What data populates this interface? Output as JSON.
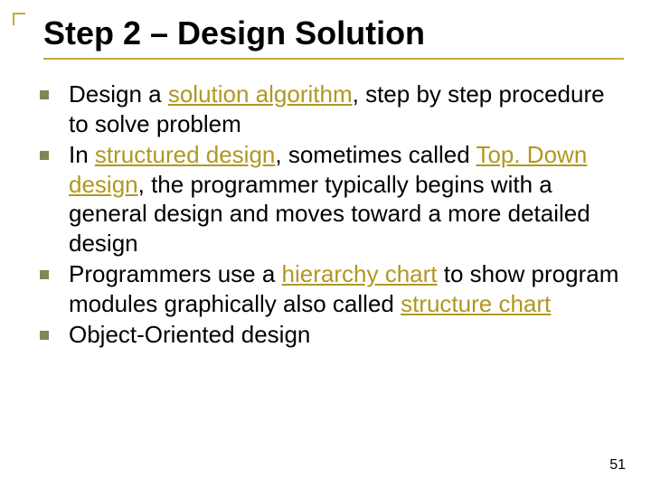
{
  "title": "Step 2 – Design Solution",
  "bullets": [
    {
      "segments": [
        {
          "text": "Design a ",
          "hl": false
        },
        {
          "text": "solution algorithm",
          "hl": true
        },
        {
          "text": ", step by step procedure to solve problem",
          "hl": false
        }
      ]
    },
    {
      "segments": [
        {
          "text": "In ",
          "hl": false
        },
        {
          "text": "structured design",
          "hl": true
        },
        {
          "text": ", sometimes called ",
          "hl": false
        },
        {
          "text": "Top. Down design",
          "hl": true
        },
        {
          "text": ", the programmer typically begins with a general design and moves toward a more detailed design",
          "hl": false
        }
      ]
    },
    {
      "segments": [
        {
          "text": "Programmers use a ",
          "hl": false
        },
        {
          "text": "hierarchy chart",
          "hl": true
        },
        {
          "text": " to show program modules graphically also called ",
          "hl": false
        },
        {
          "text": "structure chart",
          "hl": true
        }
      ]
    },
    {
      "segments": [
        {
          "text": "Object-Oriented design",
          "hl": false
        }
      ]
    }
  ],
  "page_number": "51"
}
